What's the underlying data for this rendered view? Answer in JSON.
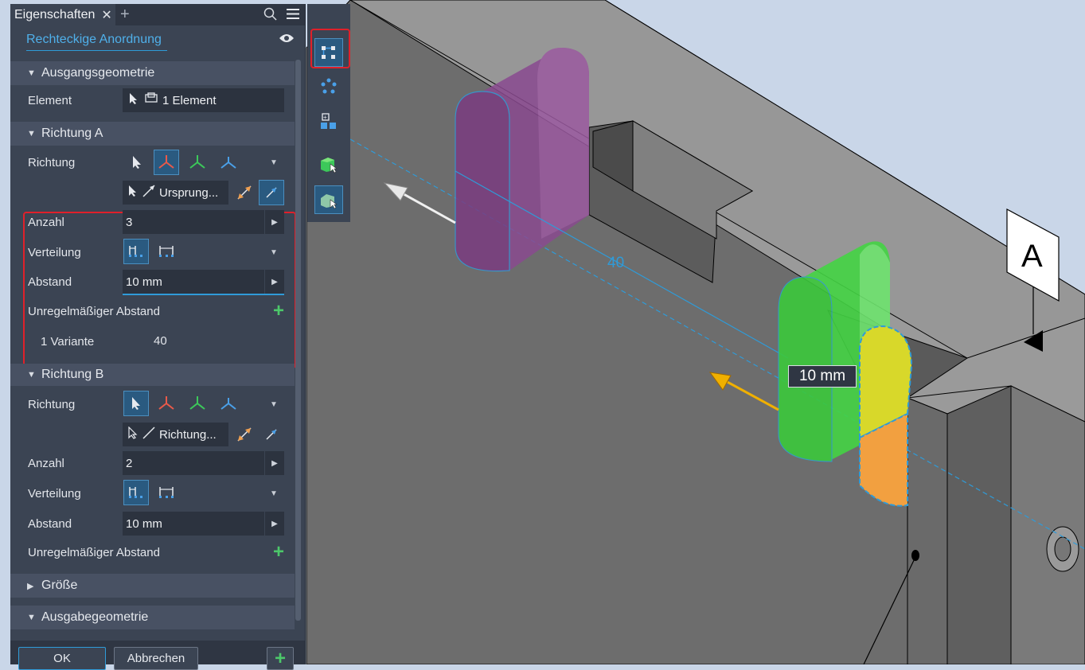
{
  "panel": {
    "tab_title": "Eigenschaften",
    "close_glyph": "✕",
    "add_tab_glyph": "+",
    "feature_name": "Rechteckige Anordnung",
    "sections": {
      "ausgangsgeometrie": {
        "title": "Ausgangsgeometrie",
        "element_label": "Element",
        "element_value": "1 Element"
      },
      "richtung_a": {
        "title": "Richtung A",
        "richtung_label": "Richtung",
        "direction_ref": "Ursprung...",
        "anzahl_label": "Anzahl",
        "anzahl_value": "3",
        "verteilung_label": "Verteilung",
        "abstand_label": "Abstand",
        "abstand_value": "10 mm",
        "unregelmaessig_label": "Unregelmäßiger Abstand",
        "variante_label": "1 Variante",
        "variante_value": "40"
      },
      "richtung_b": {
        "title": "Richtung B",
        "richtung_label": "Richtung",
        "direction_ref": "Richtung...",
        "anzahl_label": "Anzahl",
        "anzahl_value": "2",
        "verteilung_label": "Verteilung",
        "abstand_label": "Abstand",
        "abstand_value": "10 mm",
        "unregelmaessig_label": "Unregelmäßiger Abstand"
      },
      "groesse": {
        "title": "Größe"
      },
      "ausgabegeometrie": {
        "title": "Ausgabegeometrie"
      }
    },
    "footer": {
      "ok_label": "OK",
      "cancel_label": "Abbrechen"
    }
  },
  "viewport": {
    "dimension_text": "40",
    "distance_label": "10 mm",
    "datum_label": "A"
  },
  "colors": {
    "panel_bg": "#3b4453",
    "accent_blue": "#2f9bd8",
    "highlight_red": "#e0202a",
    "preview_green": "#4ee04e",
    "source_purple": "#8a4a90",
    "add_green": "#4cc86a"
  }
}
